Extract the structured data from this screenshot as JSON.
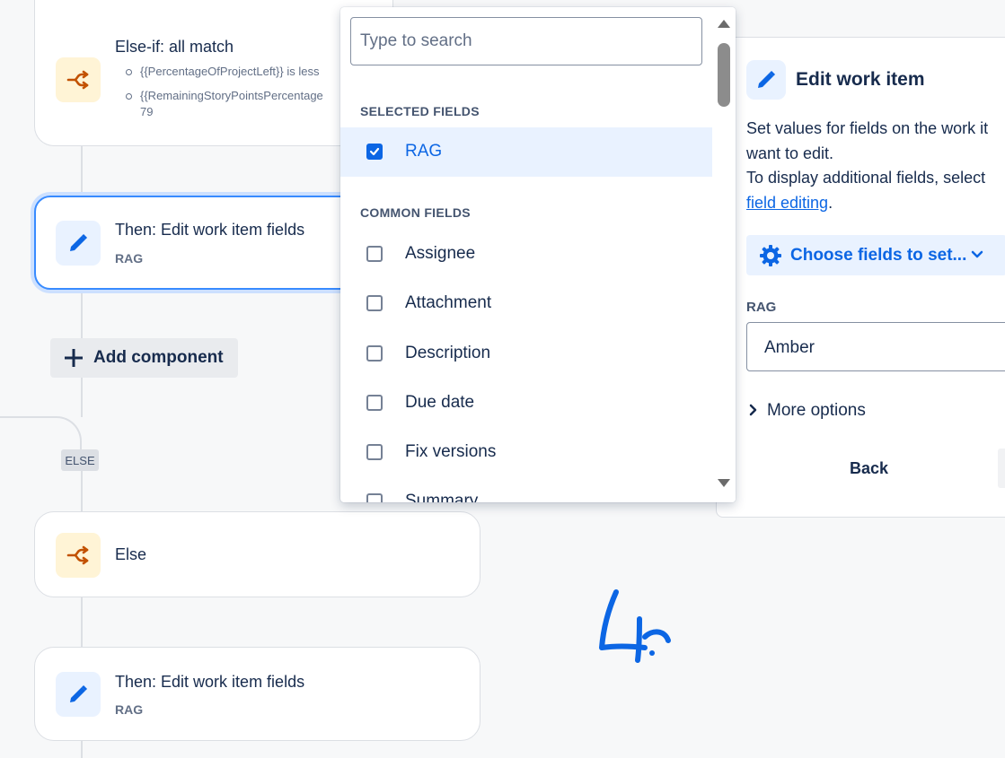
{
  "flow": {
    "else_if_card": {
      "title": "Else-if: all match",
      "conditions": [
        "{{PercentageOfProjectLeft}} is less",
        "{{RemainingStoryPointsPercentage",
        "79"
      ],
      "icon": "branch-icon"
    },
    "edit_card_1": {
      "title": "Then: Edit work item fields",
      "subtitle": "RAG",
      "icon": "pencil-icon"
    },
    "add_component_label": "Add component",
    "else_badge": "ELSE",
    "else_card": {
      "title": "Else",
      "icon": "branch-icon"
    },
    "edit_card_2": {
      "title": "Then: Edit work item fields",
      "subtitle": "RAG",
      "icon": "pencil-icon"
    }
  },
  "dropdown": {
    "search_placeholder": "Type to search",
    "selected_title": "SELECTED FIELDS",
    "selected": [
      {
        "label": "RAG",
        "checked": true
      }
    ],
    "common_title": "COMMON FIELDS",
    "common": [
      {
        "label": "Assignee",
        "checked": false
      },
      {
        "label": "Attachment",
        "checked": false
      },
      {
        "label": "Description",
        "checked": false
      },
      {
        "label": "Due date",
        "checked": false
      },
      {
        "label": "Fix versions",
        "checked": false
      },
      {
        "label": "Summary",
        "checked": false
      }
    ]
  },
  "panel": {
    "title": "Edit work item",
    "desc_line1": "Set values for fields on the work it",
    "desc_line2": "want to edit.",
    "desc_line3": "To display additional fields, select",
    "desc_link": "field editing",
    "desc_end": ".",
    "choose_button": "Choose fields to set...",
    "field_label": "RAG",
    "field_value": "Amber",
    "more_options": "More options",
    "back_button": "Back"
  },
  "colors": {
    "accent": "#0c66e4",
    "selected_border": "#388bff",
    "branch_icon": "#c25100"
  }
}
